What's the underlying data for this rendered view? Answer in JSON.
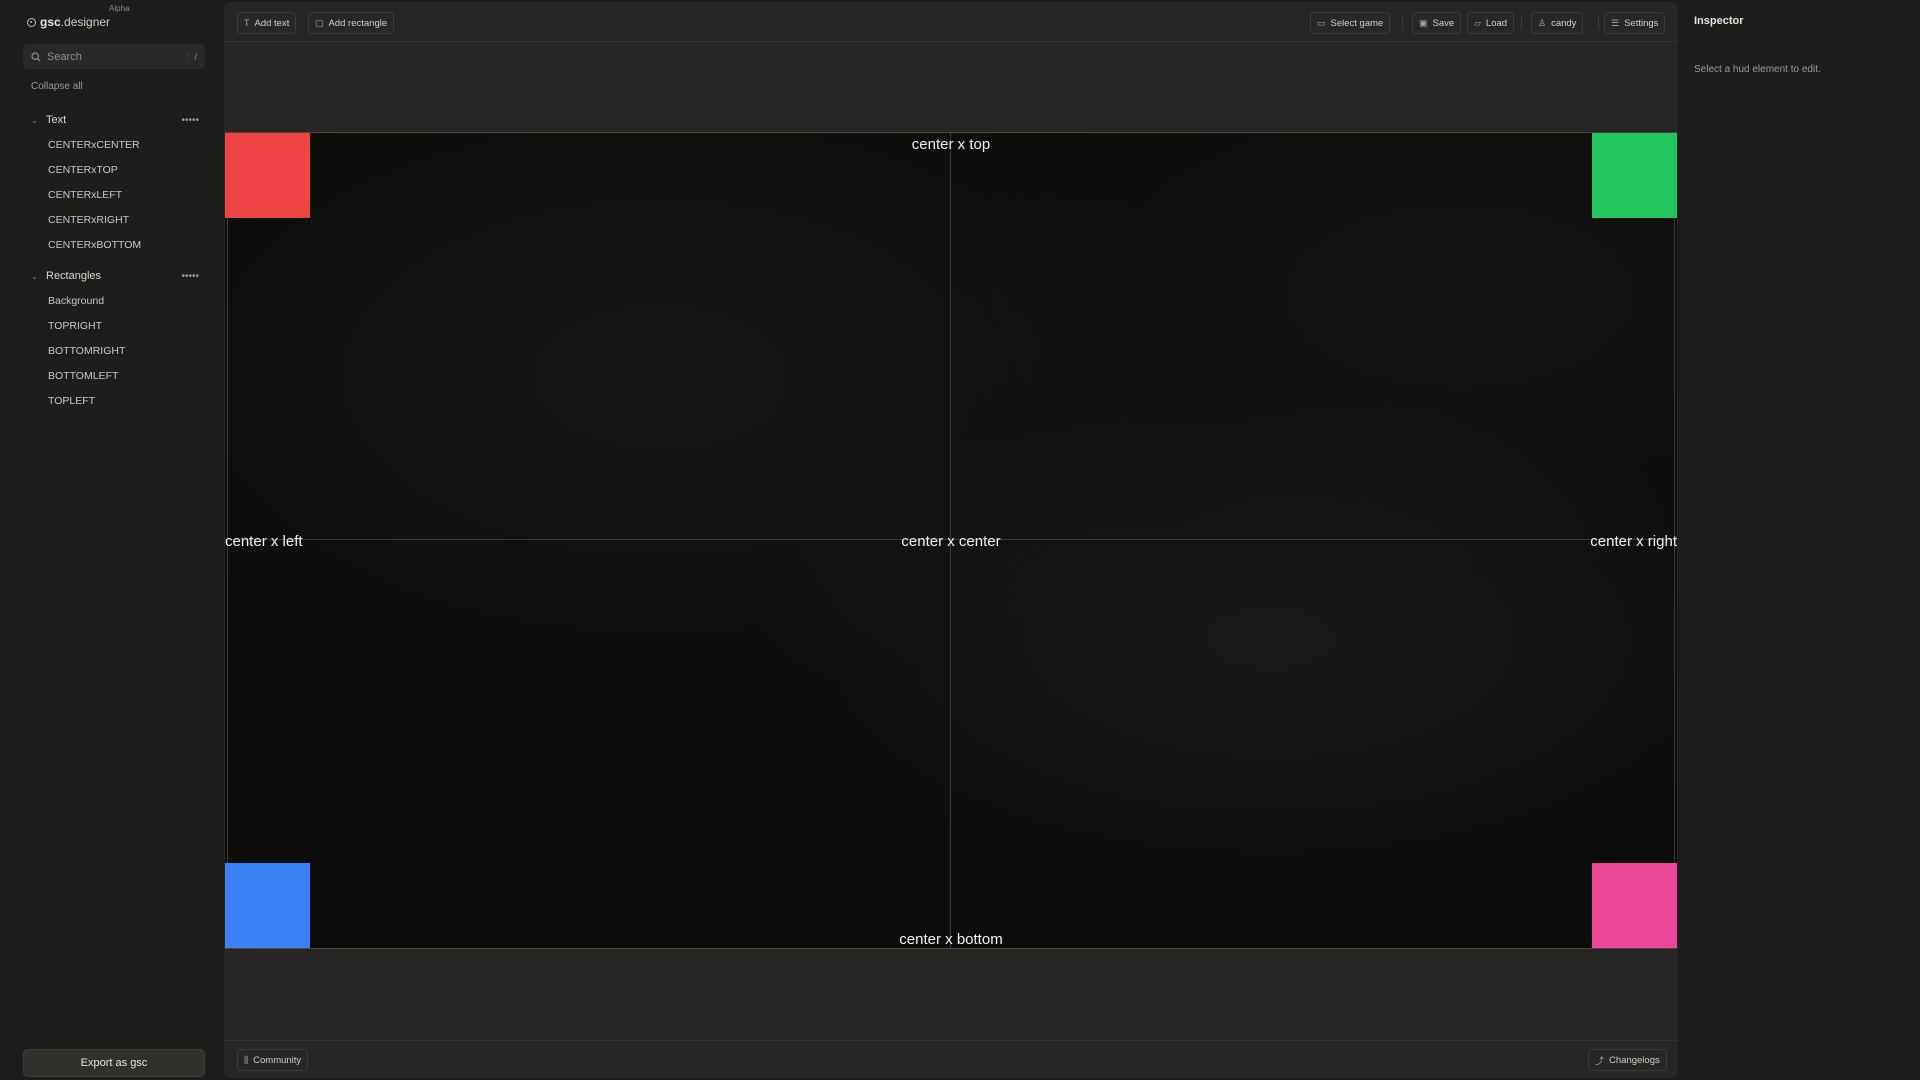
{
  "sidebar": {
    "brand_bold": "gsc",
    "brand_rest": ".designer",
    "badge": "Alpha",
    "search_placeholder": "Search",
    "search_shortcut": "/",
    "collapse_all": "Collapse all",
    "groups": [
      {
        "label": "Text",
        "menu": "•••••",
        "items": [
          "CENTERxCENTER",
          "CENTERxTOP",
          "CENTERxLEFT",
          "CENTERxRIGHT",
          "CENTERxBOTTOM"
        ]
      },
      {
        "label": "Rectangles",
        "menu": "•••••",
        "items": [
          "Background",
          "TOPRIGHT",
          "BOTTOMRIGHT",
          "BOTTOMLEFT",
          "TOPLEFT"
        ]
      }
    ],
    "export_label": "Export as gsc"
  },
  "toolbar": {
    "add_text": "Add text",
    "add_rectangle": "Add rectangle",
    "select_game": "Select game",
    "save": "Save",
    "load": "Load",
    "user": "candy",
    "settings": "Settings"
  },
  "canvas": {
    "texts": {
      "top": "center x top",
      "left": "center x left",
      "center": "center x center",
      "right": "center x right",
      "bottom": "center x bottom"
    },
    "colors": {
      "topleft": "#ef4444",
      "topright": "#22c55e",
      "bottomleft": "#3b82f6",
      "bottomright": "#ec4899"
    }
  },
  "bottombar": {
    "community": "Community",
    "changelogs": "Changelogs"
  },
  "inspector": {
    "title": "Inspector",
    "hint": "Select a hud element to edit."
  }
}
